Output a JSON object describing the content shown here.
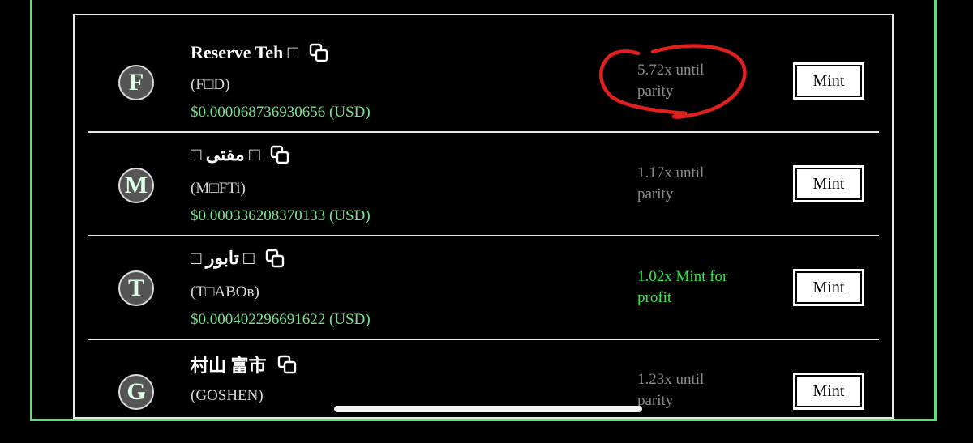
{
  "tokens": [
    {
      "avatar_letter": "F",
      "name": "Reserve Teh □",
      "symbol": "(F□D)",
      "price": "$0.000068736930656 (USD)",
      "status_line1": "5.72x until",
      "status_line2": "parity",
      "status_type": "until_parity",
      "mint_label": "Mint"
    },
    {
      "avatar_letter": "M",
      "name": "□ مفتی □",
      "symbol": "(M□FTi)",
      "price": "$0.000336208370133 (USD)",
      "status_line1": "1.17x until",
      "status_line2": "parity",
      "status_type": "until_parity",
      "mint_label": "Mint"
    },
    {
      "avatar_letter": "T",
      "name": "□ تابور □",
      "symbol": "(T□ABOв)",
      "price": "$0.000402296691622 (USD)",
      "status_line1": "1.02x Mint for",
      "status_line2": "profit",
      "status_type": "profit",
      "mint_label": "Mint"
    },
    {
      "avatar_letter": "G",
      "name": "村山 富市",
      "symbol": "(GOSHEN)",
      "price": "",
      "status_line1": "1.23x until",
      "status_line2": "parity",
      "status_type": "until_parity",
      "mint_label": "Mint"
    }
  ],
  "colors": {
    "frame_green": "#5fe07c",
    "price_green": "#7ddf8f",
    "profit_green": "#2ee84a",
    "muted_gray": "#8a8a8a",
    "annotation_red": "#e0201e"
  },
  "icons": [
    "copy-icon"
  ]
}
